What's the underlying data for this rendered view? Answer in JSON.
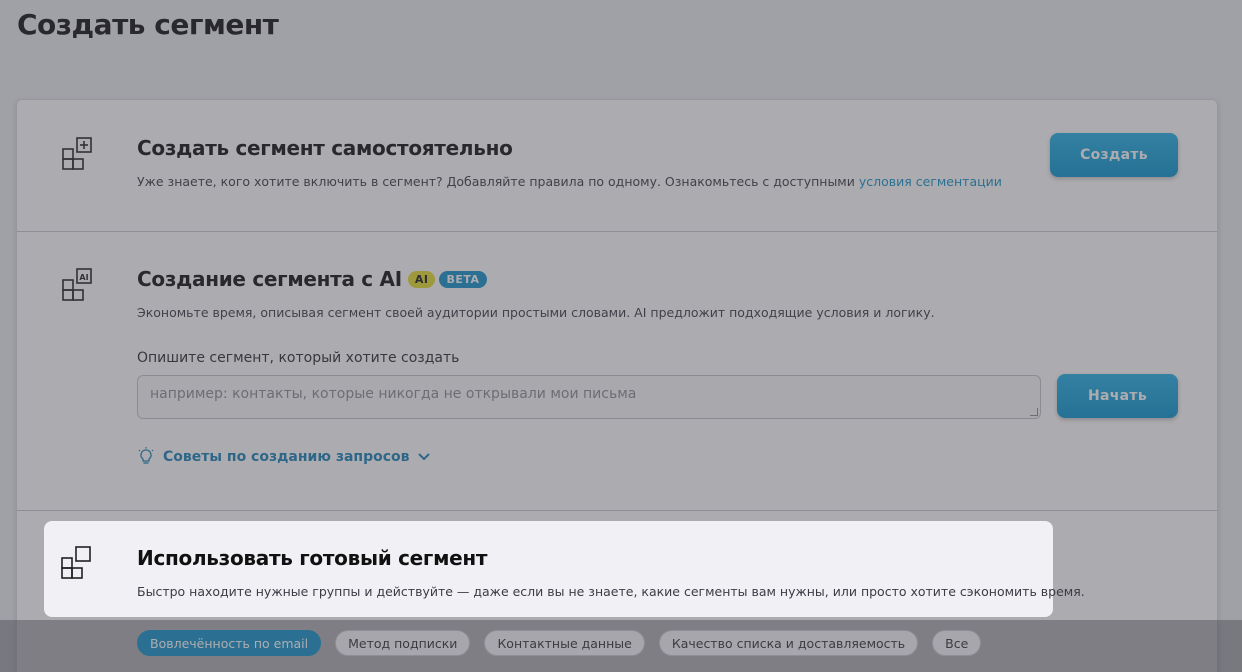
{
  "page": {
    "title": "Создать сегмент"
  },
  "manual": {
    "title": "Создать сегмент самостоятельно",
    "description": "Уже знаете, кого хотите включить в сегмент? Добавляйте правила по одному. Ознакомьтесь с доступными ",
    "link": "условия сегментации",
    "button": "Создать",
    "icon": "grid-plus-icon"
  },
  "ai": {
    "title": "Создание сегмента с AI",
    "badge_ai": "AI",
    "badge_beta": "BETA",
    "description": "Экономьте время, описывая сегмент своей аудитории простыми словами. AI предложит подходящие условия и логику.",
    "field_label": "Опишите сегмент, который хотите создать",
    "placeholder": "например: контакты, которые никогда не открывали мои письма",
    "button": "Начать",
    "tips": "Советы по созданию запросов",
    "icon": "grid-ai-icon"
  },
  "ready": {
    "title": "Использовать готовый сегмент",
    "description": "Быстро находите нужные группы и действуйте — даже если вы не знаете, какие сегменты вам нужны, или просто хотите сэкономить время.",
    "icon": "grid-squares-icon",
    "chips": [
      "Вовлечённость по email",
      "Метод подписки",
      "Контактные данные",
      "Качество списка и доставляемость",
      "Все"
    ]
  },
  "colors": {
    "accent": "#1493c9",
    "ai_badge": "#e5dc2e",
    "overlay": "#46465080"
  }
}
